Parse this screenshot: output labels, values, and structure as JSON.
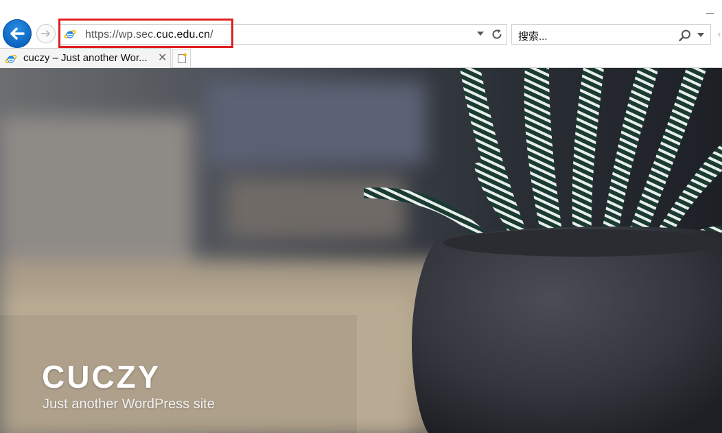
{
  "browser": {
    "address": {
      "url_prefix": "https://wp.sec.",
      "url_domain": "cuc.edu.cn",
      "url_suffix": "/"
    },
    "search": {
      "placeholder": "搜索..."
    },
    "tabs": [
      {
        "title": "cuczy – Just another Wor...",
        "close": "✕"
      }
    ],
    "icons": {
      "back": "back-arrow-icon",
      "forward": "forward-arrow-icon",
      "ie": "ie-logo-icon",
      "refresh": "refresh-icon",
      "search": "search-icon",
      "new_tab": "new-tab-icon"
    },
    "highlight_color": "#e02020",
    "accent_color": "#0b64c2"
  },
  "page": {
    "site_title": "CUCZY",
    "site_description": "Just another WordPress site"
  }
}
